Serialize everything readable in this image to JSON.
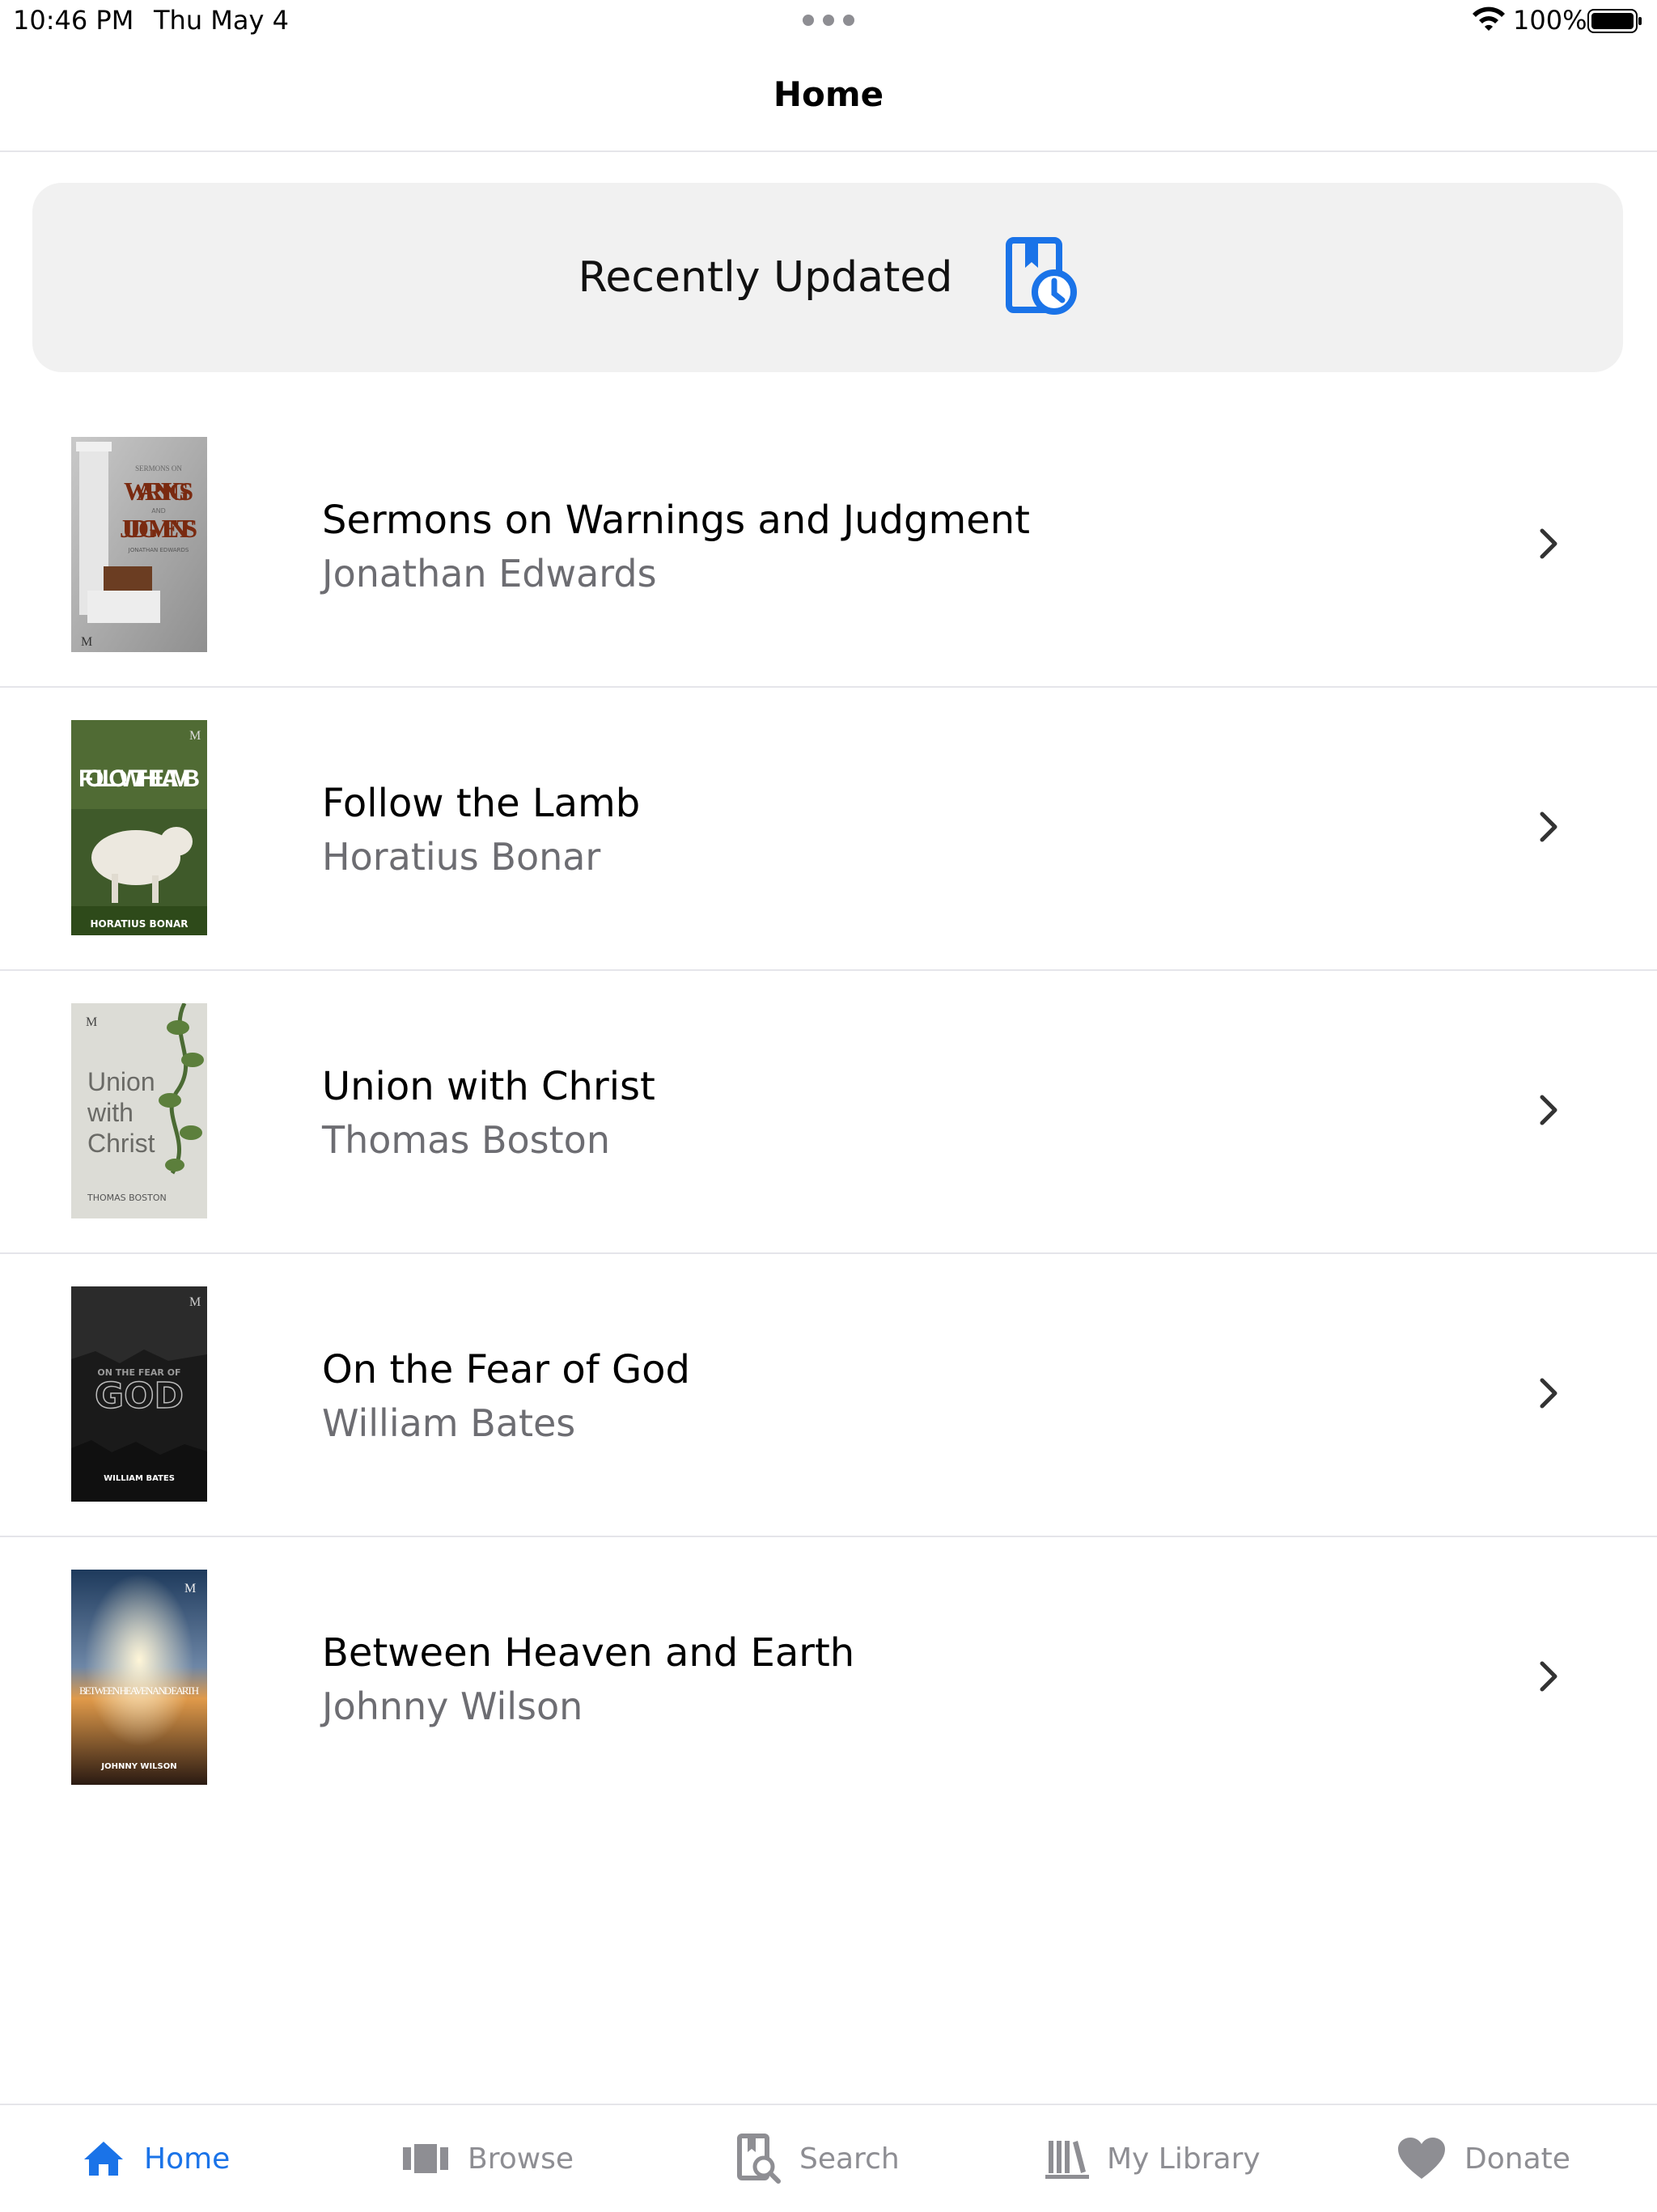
{
  "status_bar": {
    "time": "10:46 PM",
    "date": "Thu May 4",
    "battery": "100%"
  },
  "nav": {
    "title": "Home"
  },
  "recently_updated": {
    "label": "Recently Updated",
    "icon": "book-clock-icon"
  },
  "books": [
    {
      "title": "Sermons on Warnings and Judgment",
      "author": "Jonathan Edwards",
      "cover_lines": [
        "SERMONS ON",
        "WARNINGS",
        "AND",
        "JUDGMENTS",
        "JONATHAN EDWARDS"
      ]
    },
    {
      "title": "Follow the Lamb",
      "author": "Horatius Bonar",
      "cover_lines": [
        "FOLLOW THE LAMB",
        "HORATIUS BONAR"
      ]
    },
    {
      "title": "Union with Christ",
      "author": "Thomas Boston",
      "cover_lines": [
        "Union",
        "with",
        "Christ",
        "THOMAS BOSTON"
      ]
    },
    {
      "title": "On the Fear of God",
      "author": "William Bates",
      "cover_lines": [
        "ON THE FEAR OF",
        "GOD",
        "WILLIAM BATES"
      ]
    },
    {
      "title": "Between Heaven and Earth",
      "author": "Johnny Wilson",
      "cover_lines": [
        "BETWEEN HEAVEN AND EARTH",
        "JOHNNY WILSON"
      ]
    }
  ],
  "cover_mark": "M",
  "tabs": [
    {
      "label": "Home",
      "icon": "house-icon",
      "active": true
    },
    {
      "label": "Browse",
      "icon": "books-browse-icon",
      "active": false
    },
    {
      "label": "Search",
      "icon": "book-search-icon",
      "active": false
    },
    {
      "label": "My Library",
      "icon": "library-icon",
      "active": false
    },
    {
      "label": "Donate",
      "icon": "heart-icon",
      "active": false
    }
  ],
  "colors": {
    "accent": "#1a73e8",
    "inactive": "#8e8e93",
    "card_bg": "#f1f1f1"
  }
}
